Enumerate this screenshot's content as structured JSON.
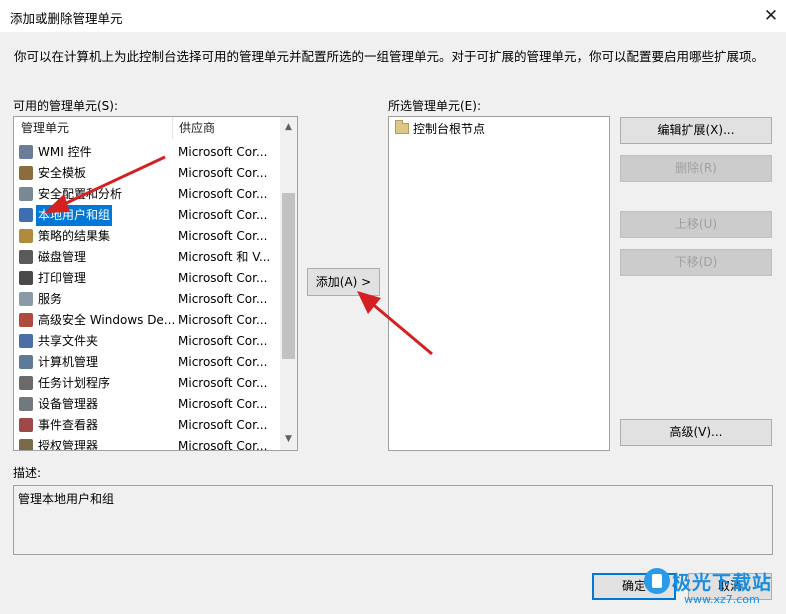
{
  "window": {
    "title": "添加或删除管理单元"
  },
  "intro": "你可以在计算机上为此控制台选择可用的管理单元并配置所选的一组管理单元。对于可扩展的管理单元，你可以配置要启用哪些扩展项。",
  "available": {
    "label": "可用的管理单元(S):",
    "col_name": "管理单元",
    "col_vendor": "供应商",
    "items": [
      {
        "name": "WMI 控件",
        "vendor": "Microsoft Cor...",
        "icon": "wmi-control-icon",
        "color": "#6b7d99"
      },
      {
        "name": "安全模板",
        "vendor": "Microsoft Cor...",
        "icon": "security-template-icon",
        "color": "#8a6d3b"
      },
      {
        "name": "安全配置和分析",
        "vendor": "Microsoft Cor...",
        "icon": "security-config-icon",
        "color": "#7a8894"
      },
      {
        "name": "本地用户和组",
        "vendor": "Microsoft Cor...",
        "icon": "users-groups-icon",
        "color": "#3d6fb0",
        "selected": true
      },
      {
        "name": "策略的结果集",
        "vendor": "Microsoft Cor...",
        "icon": "policy-result-icon",
        "color": "#b08a3d"
      },
      {
        "name": "磁盘管理",
        "vendor": "Microsoft 和 V...",
        "icon": "disk-management-icon",
        "color": "#5a5a5a"
      },
      {
        "name": "打印管理",
        "vendor": "Microsoft Cor...",
        "icon": "printer-icon",
        "color": "#4a4a4a"
      },
      {
        "name": "服务",
        "vendor": "Microsoft Cor...",
        "icon": "services-gear-icon",
        "color": "#8c9aa8"
      },
      {
        "name": "高级安全 Windows De...",
        "vendor": "Microsoft Cor...",
        "icon": "firewall-icon",
        "color": "#b04a3d"
      },
      {
        "name": "共享文件夹",
        "vendor": "Microsoft Cor...",
        "icon": "shared-folder-icon",
        "color": "#4a6fa8"
      },
      {
        "name": "计算机管理",
        "vendor": "Microsoft Cor...",
        "icon": "computer-management-icon",
        "color": "#5e7a98"
      },
      {
        "name": "任务计划程序",
        "vendor": "Microsoft Cor...",
        "icon": "task-scheduler-icon",
        "color": "#6a6a6a"
      },
      {
        "name": "设备管理器",
        "vendor": "Microsoft Cor...",
        "icon": "device-manager-icon",
        "color": "#707880"
      },
      {
        "name": "事件查看器",
        "vendor": "Microsoft Cor...",
        "icon": "event-viewer-icon",
        "color": "#a04848"
      },
      {
        "name": "授权管理器",
        "vendor": "Microsoft Cor...",
        "icon": "authorization-manager-icon",
        "color": "#7a6a4a"
      }
    ]
  },
  "add_button": "添加(A) >",
  "selected": {
    "label": "所选管理单元(E):",
    "root_node": "控制台根节点"
  },
  "buttons": {
    "edit_extensions": "编辑扩展(X)...",
    "remove": "删除(R)",
    "move_up": "上移(U)",
    "move_down": "下移(D)",
    "advanced": "高级(V)..."
  },
  "description": {
    "label": "描述:",
    "text": "管理本地用户和组"
  },
  "footer": {
    "ok": "确定",
    "cancel": "取消"
  },
  "watermark": {
    "site": "极光下载站",
    "url": "www.xz7.com"
  },
  "colors": {
    "selection": "#0078d7",
    "annotation_arrow": "#d42020",
    "watermark": "#1b8de0"
  }
}
